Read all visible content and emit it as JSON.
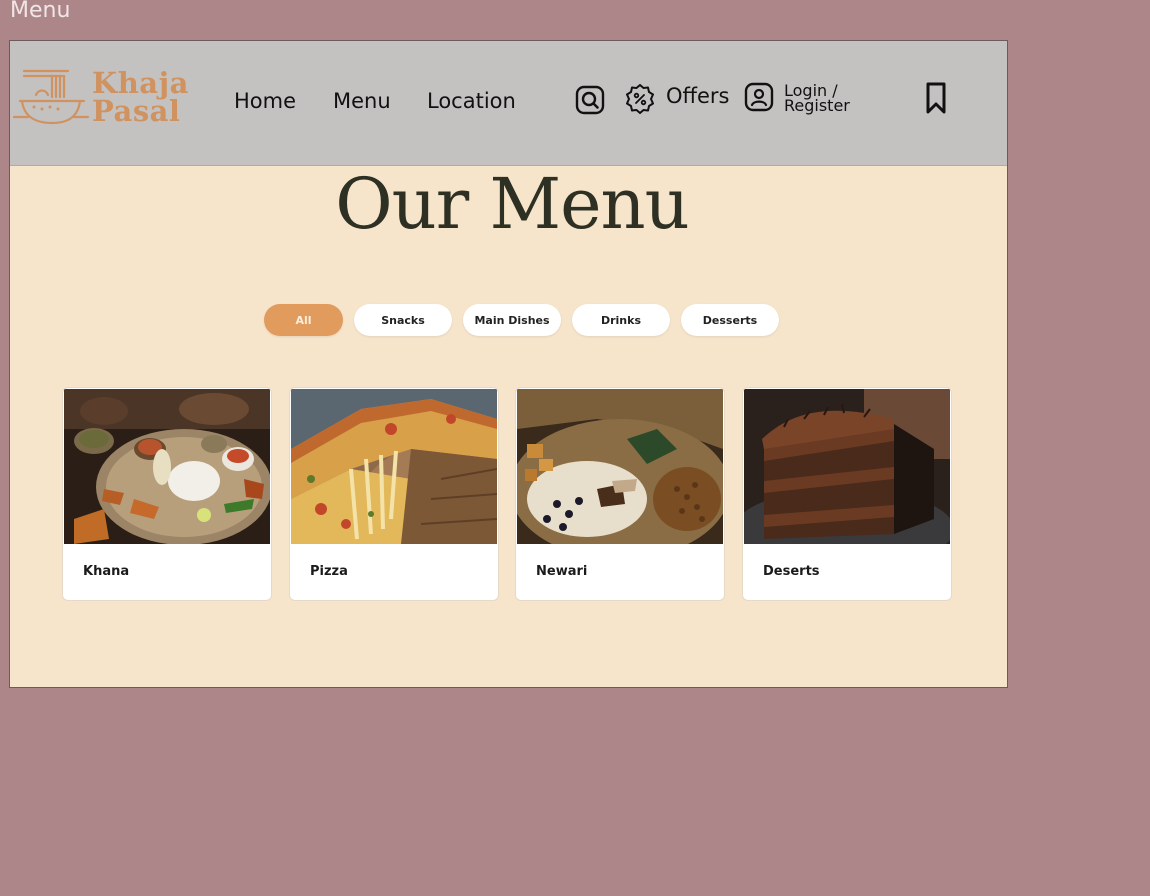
{
  "frame": {
    "label": "Menu"
  },
  "brand": {
    "line1": "Khaja",
    "line2": "Pasal",
    "color": "#d0925f"
  },
  "nav": {
    "items": [
      {
        "label": "Home"
      },
      {
        "label": "Menu"
      },
      {
        "label": "Location"
      }
    ]
  },
  "header": {
    "search_icon": "search-icon",
    "offers": {
      "label": "Offers",
      "icon": "discount-badge-icon"
    },
    "login": {
      "line1": "Login /",
      "line2": "Register",
      "icon": "user-icon"
    },
    "bookmark_icon": "bookmark-icon"
  },
  "page": {
    "title": "Our Menu"
  },
  "filters": {
    "active": "All",
    "items": [
      {
        "label": "All"
      },
      {
        "label": "Snacks"
      },
      {
        "label": "Main Dishes"
      },
      {
        "label": "Drinks"
      },
      {
        "label": "Desserts"
      }
    ]
  },
  "cards": [
    {
      "title": "Khana",
      "image": "thali-platter"
    },
    {
      "title": "Pizza",
      "image": "cheese-pizza-slice"
    },
    {
      "title": "Newari",
      "image": "newari-khaja-set"
    },
    {
      "title": "Deserts",
      "image": "chocolate-cake-slice"
    }
  ],
  "colors": {
    "background": "#ad868a",
    "header": "#c4c1c1",
    "content": "#f6e4cb",
    "accent": "#e19c5d"
  }
}
